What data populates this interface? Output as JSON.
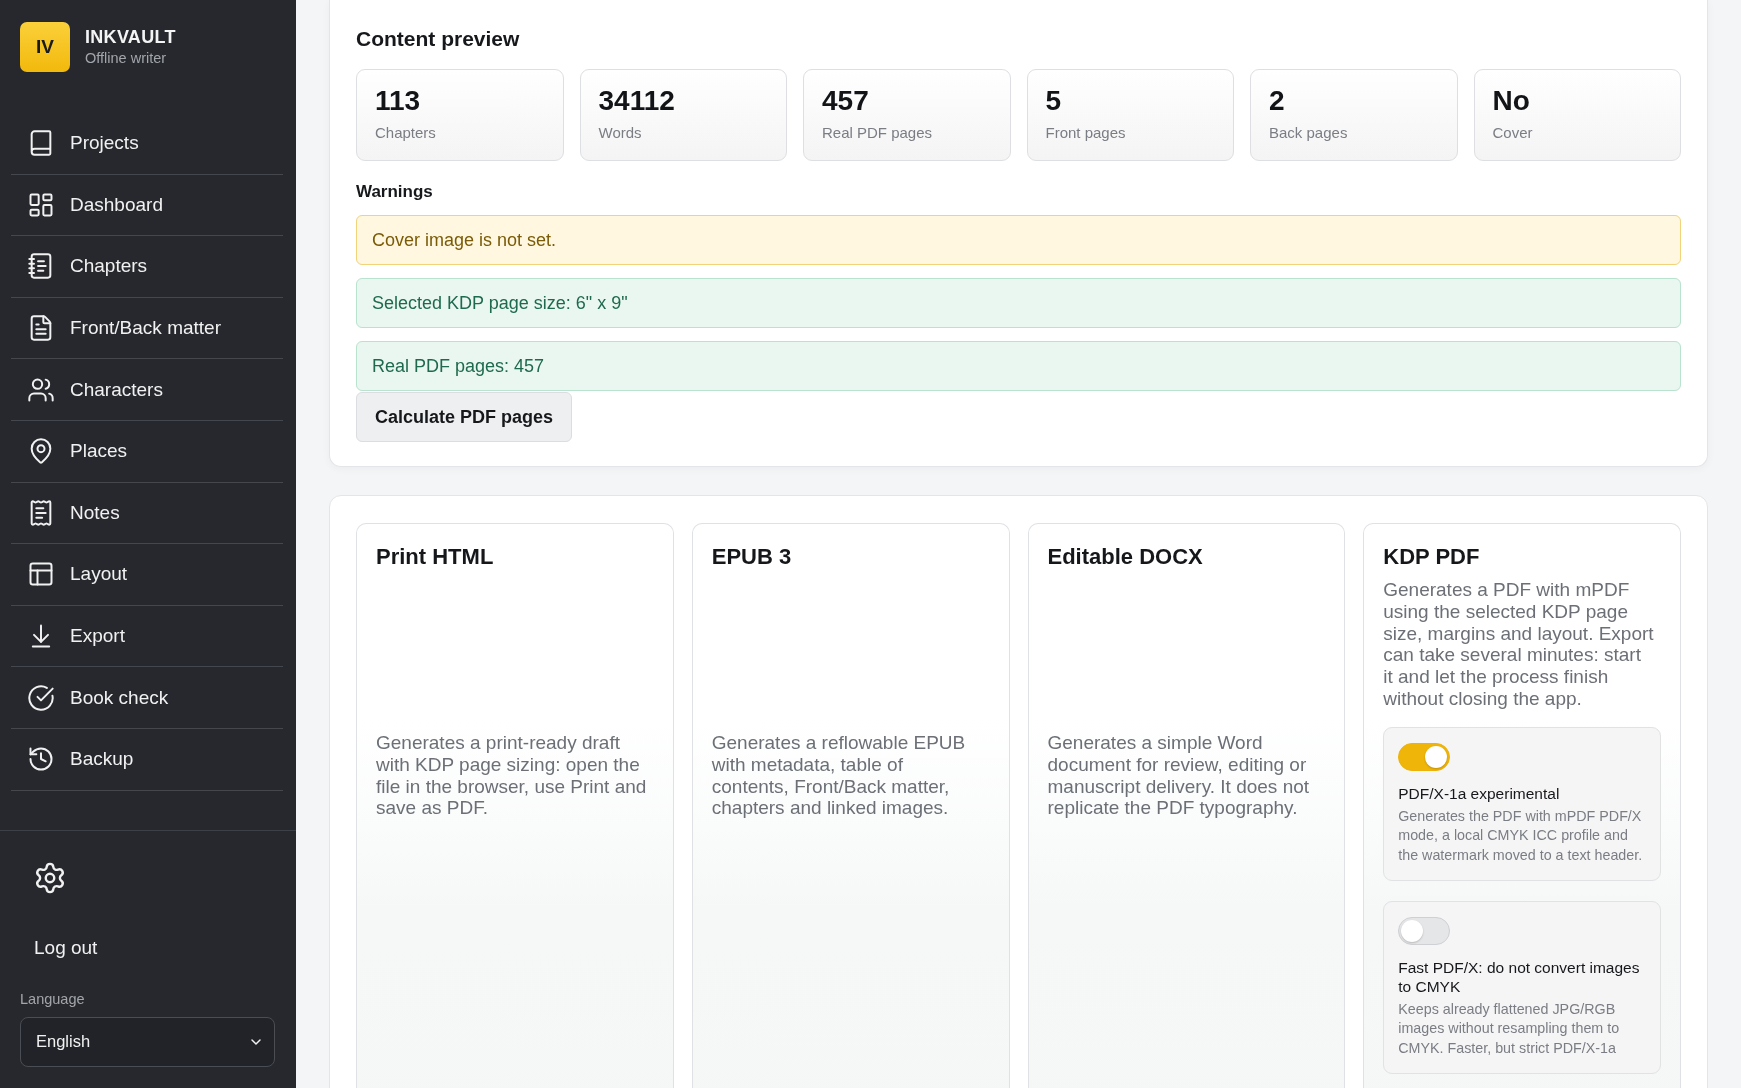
{
  "app": {
    "logo": "IV",
    "name": "INKVAULT",
    "tagline": "Offline writer"
  },
  "sidebar": {
    "items": [
      {
        "label": "Projects"
      },
      {
        "label": "Dashboard"
      },
      {
        "label": "Chapters"
      },
      {
        "label": "Front/Back matter"
      },
      {
        "label": "Characters"
      },
      {
        "label": "Places"
      },
      {
        "label": "Notes"
      },
      {
        "label": "Layout"
      },
      {
        "label": "Export"
      },
      {
        "label": "Book check"
      },
      {
        "label": "Backup"
      }
    ],
    "logout": "Log out",
    "language": {
      "label": "Language",
      "value": "English"
    }
  },
  "content_preview": {
    "title": "Content preview",
    "stats": [
      {
        "value": "113",
        "label": "Chapters"
      },
      {
        "value": "34112",
        "label": "Words"
      },
      {
        "value": "457",
        "label": "Real PDF pages"
      },
      {
        "value": "5",
        "label": "Front pages"
      },
      {
        "value": "2",
        "label": "Back pages"
      },
      {
        "value": "No",
        "label": "Cover"
      }
    ],
    "warnings_title": "Warnings",
    "alerts": [
      {
        "kind": "warning",
        "text": "Cover image is not set."
      },
      {
        "kind": "success",
        "text": "Selected KDP page size: 6\" x 9\""
      },
      {
        "kind": "success",
        "text": "Real PDF pages: 457"
      }
    ],
    "button": "Calculate PDF pages"
  },
  "export_formats": [
    {
      "title": "Print HTML",
      "description": "Generates a print-ready draft with KDP page sizing: open the file in the browser, use Print and save as PDF."
    },
    {
      "title": "EPUB 3",
      "description": "Generates a reflowable EPUB with metadata, table of contents, Front/Back matter, chapters and linked images."
    },
    {
      "title": "Editable DOCX",
      "description": "Generates a simple Word document for review, editing or manuscript delivery. It does not replicate the PDF typography."
    },
    {
      "title": "KDP PDF",
      "description": "Generates a PDF with mPDF using the selected KDP page size, margins and layout. Export can take several minutes: start it and let the process finish without closing the app.",
      "options": [
        {
          "label": "PDF/X-1a experimental",
          "description": "Generates the PDF with mPDF PDF/X mode, a local CMYK ICC profile and the watermark moved to a text header.",
          "on": true
        },
        {
          "label": "Fast PDF/X: do not convert images to CMYK",
          "description": "Keeps already flattened JPG/RGB images without resampling them to CMYK. Faster, but strict PDF/X-1a",
          "on": false
        }
      ]
    }
  ]
}
